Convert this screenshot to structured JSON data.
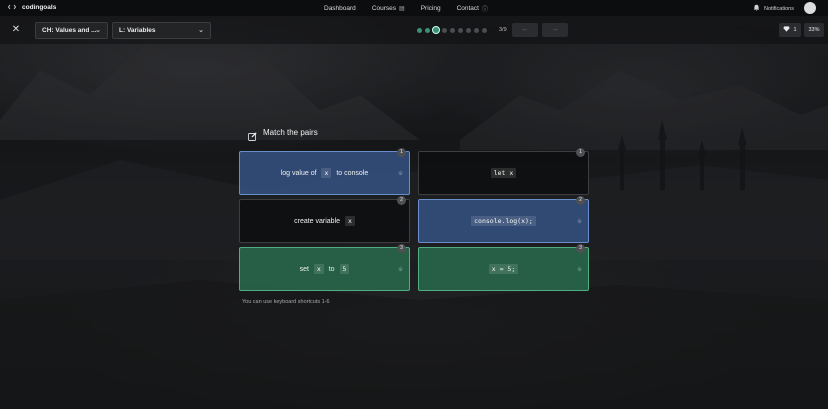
{
  "nav": {
    "brand": "codingoals",
    "links": [
      "Dashboard",
      "Courses",
      "Pricing",
      "Contact"
    ],
    "notifications": "Notifications"
  },
  "toolbar": {
    "chapter_select": "CH: Values and ...",
    "lesson_select": "L: Variables",
    "progress": {
      "current": 3,
      "total": 9,
      "label": "3/9"
    },
    "gems": "1",
    "percent": "33%"
  },
  "exercise": {
    "title": "Match the pairs",
    "left_cards": [
      {
        "number": "1",
        "state": "selected",
        "parts": [
          "log value of ",
          "x",
          " to console"
        ]
      },
      {
        "number": "2",
        "state": "neutral",
        "parts": [
          "create variable ",
          "x"
        ]
      },
      {
        "number": "3",
        "state": "matched",
        "parts": [
          "set ",
          "x",
          " to ",
          "5"
        ]
      }
    ],
    "right_cards": [
      {
        "number": "1",
        "state": "neutral",
        "code": "let x"
      },
      {
        "number": "2",
        "state": "selected",
        "code": "console.log(x);"
      },
      {
        "number": "3",
        "state": "matched",
        "code": "x = 5;"
      }
    ],
    "footnote": "You can use keyboard shortcuts 1-6"
  },
  "colors": {
    "selected": "#345282",
    "matched": "#286e4e",
    "progress_done": "#3d8f78"
  }
}
